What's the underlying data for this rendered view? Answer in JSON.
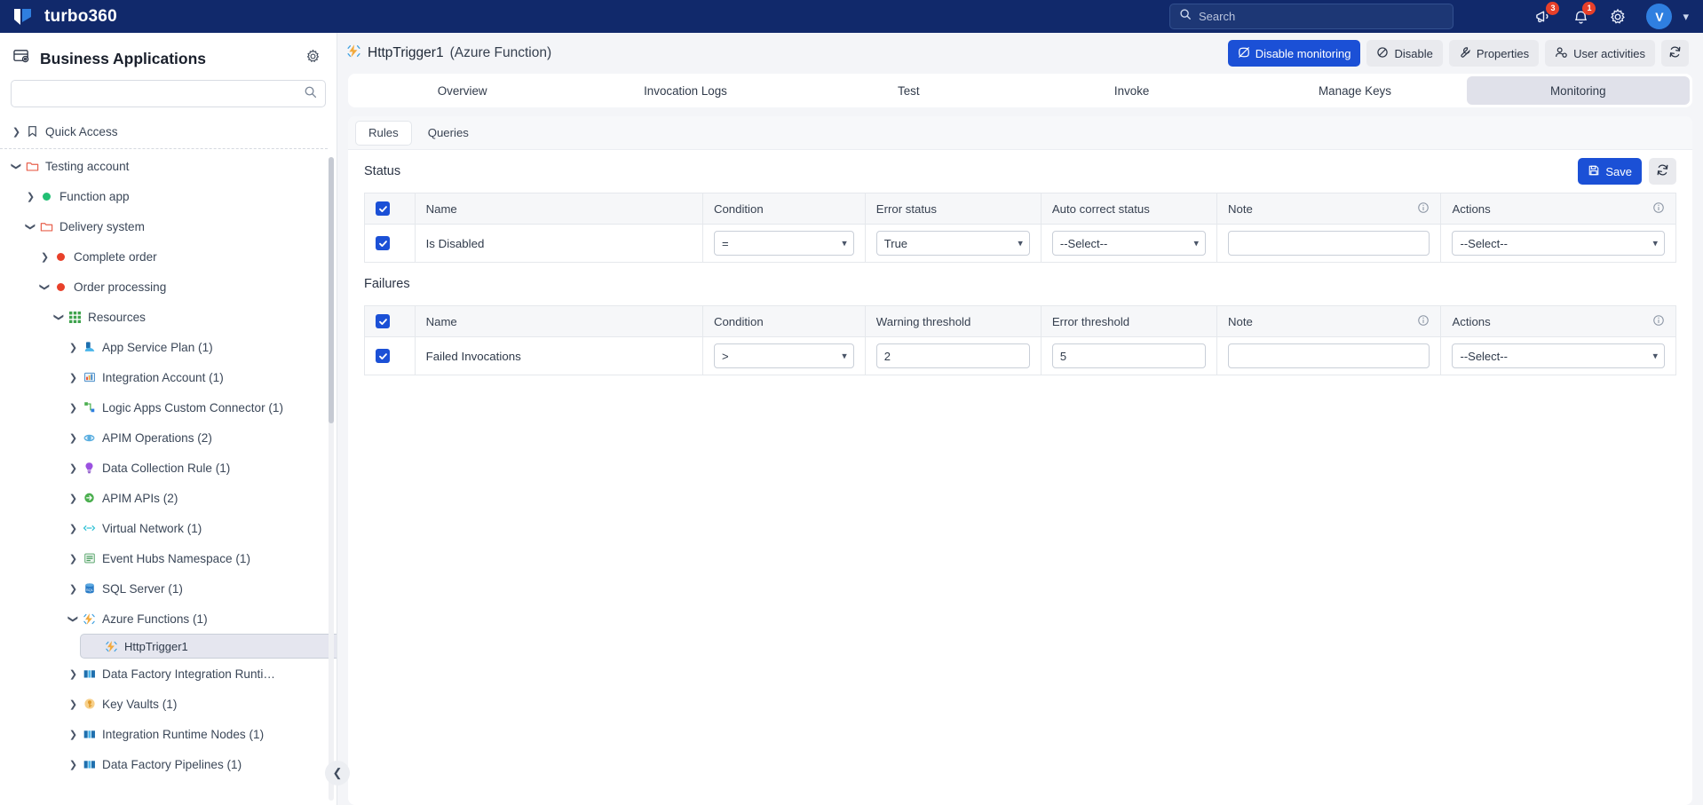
{
  "topbar": {
    "brand": "turbo360",
    "search_placeholder": "Search",
    "announcements_icon": "megaphone-icon",
    "announcements_badge": "3",
    "notifications_icon": "bell-icon",
    "notifications_badge": "1",
    "settings_icon": "gear-icon",
    "avatar_initial": "V",
    "avatar_chevron": "chevron-down-icon",
    "accent": "#11296b"
  },
  "sidebar": {
    "title": "Business Applications",
    "settings_icon": "gear-icon",
    "search_value": "",
    "search_placeholder": "",
    "search_icon": "search-icon",
    "collapse_icon": "chevron-left-icon",
    "tree": [
      {
        "label": "Quick Access",
        "indent": 0,
        "twist": "right",
        "icon": "bookmark-icon",
        "icon_color": "#3b4758",
        "divider_after": true
      },
      {
        "label": "Testing account",
        "indent": 0,
        "twist": "down",
        "icon": "folder-icon",
        "icon_color": "#e8604c"
      },
      {
        "label": "Function app",
        "indent": 1,
        "twist": "right",
        "icon": "status-dot",
        "icon_color": "#21bf73"
      },
      {
        "label": "Delivery system",
        "indent": 1,
        "twist": "down",
        "icon": "folder-icon",
        "icon_color": "#e8604c"
      },
      {
        "label": "Complete order",
        "indent": 2,
        "twist": "right",
        "icon": "status-dot",
        "icon_color": "#e8402a"
      },
      {
        "label": "Order processing",
        "indent": 2,
        "twist": "down",
        "icon": "status-dot",
        "icon_color": "#e8402a"
      },
      {
        "label": "Resources",
        "indent": 3,
        "twist": "down",
        "icon": "grid-icon",
        "icon_color": "#3fa34d"
      },
      {
        "label": "App Service Plan (1)",
        "indent": 4,
        "twist": "right",
        "icon": "app-service-plan-icon",
        "icon_color": "#3fa0e0"
      },
      {
        "label": "Integration Account (1)",
        "indent": 4,
        "twist": "right",
        "icon": "integration-account-icon",
        "icon_color": "#4a90d9"
      },
      {
        "label": "Logic Apps Custom Connector (1)",
        "indent": 4,
        "twist": "right",
        "icon": "custom-connector-icon",
        "icon_color": "#5cb85c"
      },
      {
        "label": "APIM Operations (2)",
        "indent": 4,
        "twist": "right",
        "icon": "apim-operations-icon",
        "icon_color": "#5aaee0"
      },
      {
        "label": "Data Collection Rule (1)",
        "indent": 4,
        "twist": "right",
        "icon": "data-collection-rule-icon",
        "icon_color": "#9b51e0"
      },
      {
        "label": "APIM APIs (2)",
        "indent": 4,
        "twist": "right",
        "icon": "apim-apis-icon",
        "icon_color": "#4caf50"
      },
      {
        "label": "Virtual Network (1)",
        "indent": 4,
        "twist": "right",
        "icon": "virtual-network-icon",
        "icon_color": "#34c3d6"
      },
      {
        "label": "Event Hubs Namespace (1)",
        "indent": 4,
        "twist": "right",
        "icon": "event-hubs-icon",
        "icon_color": "#4a9e5f"
      },
      {
        "label": "SQL Server (1)",
        "indent": 4,
        "twist": "right",
        "icon": "sql-server-icon",
        "icon_color": "#2a7cc7"
      },
      {
        "label": "Azure Functions (1)",
        "indent": 4,
        "twist": "down",
        "icon": "azure-function-icon",
        "icon_color": "#f2a93b"
      },
      {
        "label": "HttpTrigger1",
        "indent": 5,
        "twist": "none",
        "icon": "azure-function-icon",
        "icon_color": "#f2a93b",
        "selected": true
      },
      {
        "label": "Data Factory Integration Runti…",
        "indent": 4,
        "twist": "right",
        "icon": "data-factory-icon",
        "icon_color": "#3fa0e0"
      },
      {
        "label": "Key Vaults (1)",
        "indent": 4,
        "twist": "right",
        "icon": "key-vault-icon",
        "icon_color": "#f2b33b"
      },
      {
        "label": "Integration Runtime Nodes (1)",
        "indent": 4,
        "twist": "right",
        "icon": "data-factory-icon",
        "icon_color": "#3fa0e0"
      },
      {
        "label": "Data Factory Pipelines (1)",
        "indent": 4,
        "twist": "right",
        "icon": "data-factory-icon",
        "icon_color": "#3fa0e0"
      }
    ]
  },
  "resource": {
    "icon": "azure-function-icon",
    "name": "HttpTrigger1",
    "type": "(Azure Function)",
    "actions": [
      {
        "label": "Disable monitoring",
        "icon": "monitor-off-icon",
        "primary": true
      },
      {
        "label": "Disable",
        "icon": "ban-icon",
        "primary": false
      },
      {
        "label": "Properties",
        "icon": "wrench-icon",
        "primary": false
      },
      {
        "label": "User activities",
        "icon": "user-activity-icon",
        "primary": false
      }
    ],
    "refresh_icon": "refresh-icon"
  },
  "tabs": [
    {
      "label": "Overview",
      "active": false
    },
    {
      "label": "Invocation Logs",
      "active": false
    },
    {
      "label": "Test",
      "active": false
    },
    {
      "label": "Invoke",
      "active": false
    },
    {
      "label": "Manage Keys",
      "active": false
    },
    {
      "label": "Monitoring",
      "active": true
    }
  ],
  "subtabs": [
    {
      "label": "Rules",
      "active": true
    },
    {
      "label": "Queries",
      "active": false
    }
  ],
  "toolbar": {
    "save_label": "Save",
    "save_icon": "save-icon",
    "refresh_icon": "refresh-icon"
  },
  "status_section": {
    "title": "Status",
    "header_checkbox_checked": true,
    "columns": [
      {
        "label": "",
        "key": "chk",
        "info": false
      },
      {
        "label": "Name",
        "key": "name",
        "info": false
      },
      {
        "label": "Condition",
        "key": "cond",
        "info": false
      },
      {
        "label": "Error status",
        "key": "err",
        "info": false
      },
      {
        "label": "Auto correct status",
        "key": "auto",
        "info": false
      },
      {
        "label": "Note",
        "key": "note",
        "info": true
      },
      {
        "label": "Actions",
        "key": "act",
        "info": true
      }
    ],
    "rows": [
      {
        "checked": true,
        "name": "Is Disabled",
        "condition": "=",
        "error_status": "True",
        "auto_correct_status": "--Select--",
        "note": "",
        "actions": "--Select--"
      }
    ]
  },
  "failures_section": {
    "title": "Failures",
    "header_checkbox_checked": true,
    "columns": [
      {
        "label": "",
        "key": "chk",
        "info": false
      },
      {
        "label": "Name",
        "key": "name",
        "info": false
      },
      {
        "label": "Condition",
        "key": "cond",
        "info": false
      },
      {
        "label": "Warning threshold",
        "key": "warn",
        "info": false
      },
      {
        "label": "Error threshold",
        "key": "errt",
        "info": false
      },
      {
        "label": "Note",
        "key": "note",
        "info": true
      },
      {
        "label": "Actions",
        "key": "act",
        "info": true
      }
    ],
    "rows": [
      {
        "checked": true,
        "name": "Failed Invocations",
        "condition": ">",
        "warning_threshold": "2",
        "error_threshold": "5",
        "note": "",
        "actions": "--Select--"
      }
    ]
  },
  "colors": {
    "brand_navy": "#11296b",
    "primary_blue": "#1b50d6",
    "badge_red": "#e8402a",
    "ok_green": "#21bf73"
  }
}
